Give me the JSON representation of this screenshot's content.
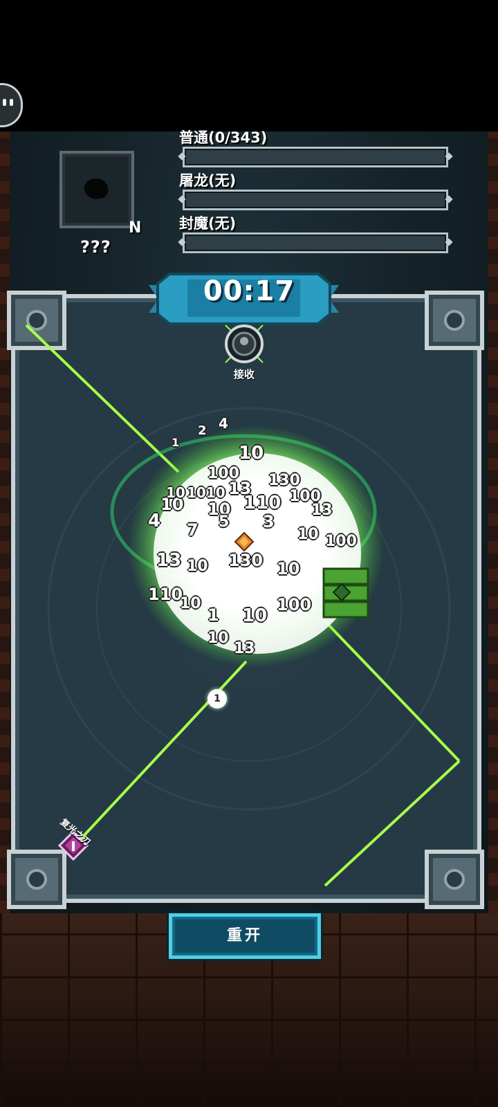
{
  "hud": {
    "item_name": "???",
    "item_rank": "N",
    "bars": [
      {
        "label": "普通(0/343)",
        "fill": 0.0
      },
      {
        "label": "屠龙(无)",
        "fill": 0.0
      },
      {
        "label": "封魔(无)",
        "fill": 0.0
      }
    ],
    "timer": "00:17"
  },
  "arena": {
    "receiver_label": "接收",
    "weapon_label": "复光之刃",
    "orb_value": "1",
    "damage_numbers": [
      "10",
      "100",
      "13",
      "130",
      "10",
      "1010",
      "10",
      "110",
      "100",
      "13",
      "10",
      "1",
      "2",
      "4",
      "4",
      "7",
      "5",
      "3",
      "10",
      "100",
      "13",
      "10",
      "130",
      "10",
      "110",
      "10",
      "1",
      "10",
      "100",
      "10",
      "13"
    ]
  },
  "buttons": {
    "restart": "重开"
  },
  "colors": {
    "laser": "#9cff3a",
    "accent": "#4fd0e3",
    "frame": "#c9d1d4"
  },
  "icons": {
    "pause": "pause-icon",
    "receiver": "target-icon",
    "weapon": "gem-sword-icon",
    "core": "orange-gem-icon"
  }
}
